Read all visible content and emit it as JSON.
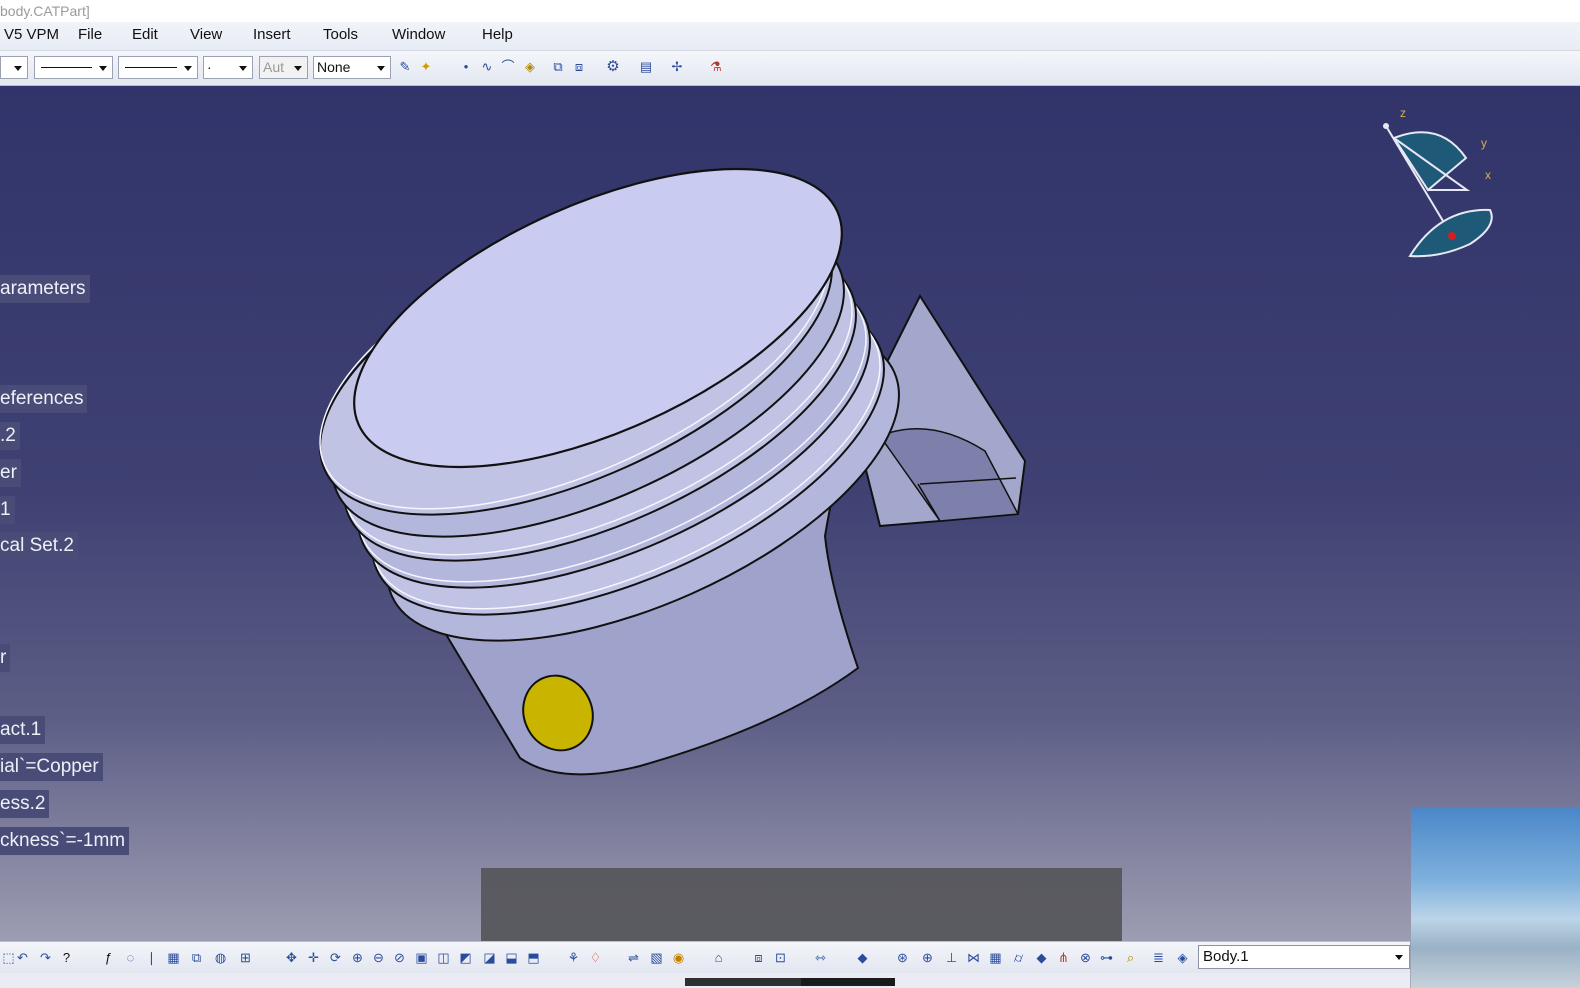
{
  "window": {
    "title": "body.CATPart]"
  },
  "menu": {
    "items": [
      {
        "label": "V5 VPM"
      },
      {
        "label": "File"
      },
      {
        "label": "Edit"
      },
      {
        "label": "View"
      },
      {
        "label": "Insert"
      },
      {
        "label": "Tools"
      },
      {
        "label": "Window"
      },
      {
        "label": "Help"
      }
    ]
  },
  "toolbar": {
    "weight_value": "Aut",
    "layer_value": "None",
    "point_value": "·"
  },
  "tree": {
    "items": [
      {
        "label": "arameters"
      },
      {
        "label": "eferences"
      },
      {
        "label": ".2"
      },
      {
        "label": "er"
      },
      {
        "label": "1"
      },
      {
        "label": "cal Set.2"
      },
      {
        "label": "r"
      },
      {
        "label": "act.1"
      },
      {
        "label": "ial`=Copper"
      },
      {
        "label": "ess.2"
      },
      {
        "label": "ckness`=-1mm"
      }
    ]
  },
  "compass": {
    "axis_z": "z",
    "axis_y": "y",
    "axis_x": "x"
  },
  "bottom_toolbar": {
    "current_body": "Body.1"
  },
  "progress": {
    "fraction": 0.55
  },
  "colors": {
    "viewport_top": "#31346a",
    "part_face": "#c9cbf0",
    "pin_hole": "#c9b400",
    "compass_accent": "#1e5a78",
    "compass_label": "#d6b04a"
  }
}
